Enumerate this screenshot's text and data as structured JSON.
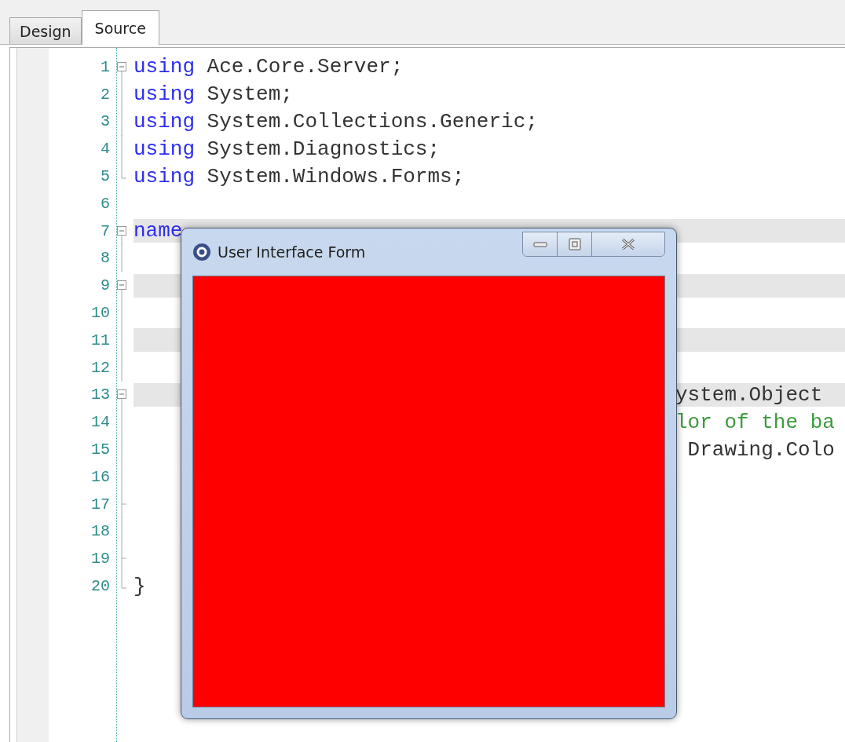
{
  "tabs": [
    {
      "label": "Design",
      "selected": false
    },
    {
      "label": "Source",
      "selected": true
    }
  ],
  "editor": {
    "lines": [
      {
        "number": "1",
        "kind": "start",
        "highlighted": false,
        "segments": [
          {
            "text": "using",
            "kind": "keyword"
          },
          {
            "text": " Ace.Core.Server;",
            "kind": "plain"
          }
        ]
      },
      {
        "number": "2",
        "kind": "line",
        "highlighted": false,
        "segments": [
          {
            "text": "using",
            "kind": "keyword"
          },
          {
            "text": " System;",
            "kind": "plain"
          }
        ]
      },
      {
        "number": "3",
        "kind": "line",
        "highlighted": false,
        "segments": [
          {
            "text": "using",
            "kind": "keyword"
          },
          {
            "text": " System.Collections.Generic;",
            "kind": "plain"
          }
        ]
      },
      {
        "number": "4",
        "kind": "line",
        "highlighted": false,
        "segments": [
          {
            "text": "using",
            "kind": "keyword"
          },
          {
            "text": " System.Diagnostics;",
            "kind": "plain"
          }
        ]
      },
      {
        "number": "5",
        "kind": "end",
        "highlighted": false,
        "segments": [
          {
            "text": "using",
            "kind": "keyword"
          },
          {
            "text": " System.Windows.Forms;",
            "kind": "plain"
          }
        ]
      },
      {
        "number": "6",
        "kind": "none",
        "highlighted": false
      },
      {
        "number": "7",
        "kind": "start",
        "highlighted": true,
        "segments": [
          {
            "text": "name",
            "kind": "keyword"
          }
        ]
      },
      {
        "number": "8",
        "kind": "line",
        "highlighted": false
      },
      {
        "number": "9",
        "kind": "start",
        "highlighted": true
      },
      {
        "number": "10",
        "kind": "line",
        "highlighted": false
      },
      {
        "number": "11",
        "kind": "line",
        "highlighted": true
      },
      {
        "number": "12",
        "kind": "line",
        "highlighted": false
      },
      {
        "number": "13",
        "kind": "start",
        "highlighted": true,
        "behind_window": true,
        "segments": [
          {
            "text": "ystem.Object",
            "kind": "plain"
          }
        ]
      },
      {
        "number": "14",
        "kind": "line",
        "highlighted": false,
        "behind_window": true,
        "segments": [
          {
            "text": "lor of the ba",
            "kind": "comment"
          }
        ]
      },
      {
        "number": "15",
        "kind": "line",
        "highlighted": false,
        "behind_window": true,
        "segments": [
          {
            "text": " Drawing.Colo",
            "kind": "plain"
          }
        ]
      },
      {
        "number": "16",
        "kind": "line",
        "highlighted": false
      },
      {
        "number": "17",
        "kind": "tick",
        "highlighted": false
      },
      {
        "number": "18",
        "kind": "line",
        "highlighted": false
      },
      {
        "number": "19",
        "kind": "tick",
        "highlighted": false
      },
      {
        "number": "20",
        "kind": "end",
        "highlighted": false,
        "segments": [
          {
            "text": "}",
            "kind": "plain"
          }
        ]
      }
    ]
  },
  "form_window": {
    "title": "User Interface Form"
  }
}
